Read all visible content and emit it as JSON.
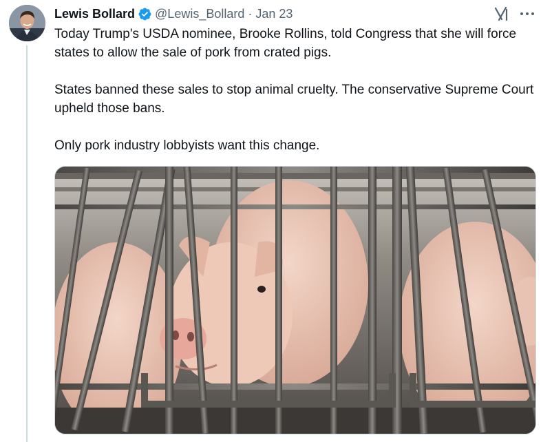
{
  "tweet": {
    "author": {
      "name": "Lewis Bollard",
      "handle": "@Lewis_Bollard",
      "verified": true
    },
    "separator": "·",
    "date": "Jan 23",
    "paragraphs": [
      "Today Trump's USDA nominee, Brooke Rollins, told Congress that she will force states to allow the sale of pork from crated pigs.",
      "States banned these sales to stop animal cruelty. The conservative Supreme Court upheld those bans.",
      "Only pork industry lobbyists want this change."
    ],
    "icons": {
      "verified": "verified-badge-icon",
      "grok": "grok-icon",
      "more": "more-options-icon"
    },
    "colors": {
      "text": "#0f1419",
      "secondary": "#536471",
      "verified_blue": "#1d9bf0",
      "border": "#cfd9de"
    }
  }
}
